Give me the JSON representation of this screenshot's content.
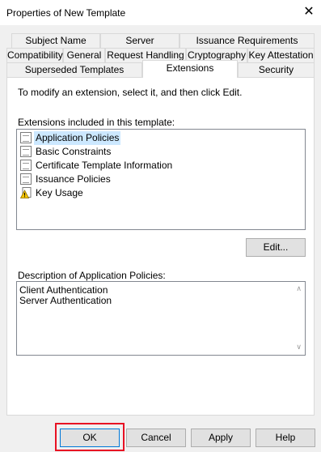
{
  "window": {
    "title": "Properties of New Template",
    "close_glyph": "✕"
  },
  "tabs": {
    "row1": [
      "Subject Name",
      "Server",
      "Issuance Requirements"
    ],
    "row2": [
      "Compatibility",
      "General",
      "Request Handling",
      "Cryptography",
      "Key Attestation"
    ],
    "row3": [
      "Superseded Templates",
      "Extensions",
      "Security"
    ],
    "active": "Extensions"
  },
  "extensions_tab": {
    "instruction": "To modify an extension, select it, and then click Edit.",
    "list_label": "Extensions included in this template:",
    "extensions": [
      {
        "label": "Application Policies",
        "icon": "document-icon",
        "selected": true
      },
      {
        "label": "Basic Constraints",
        "icon": "document-icon",
        "selected": false
      },
      {
        "label": "Certificate Template Information",
        "icon": "document-icon",
        "selected": false
      },
      {
        "label": "Issuance Policies",
        "icon": "document-icon",
        "selected": false
      },
      {
        "label": "Key Usage",
        "icon": "warning-document-icon",
        "selected": false
      }
    ],
    "edit_button": "Edit...",
    "description_label": "Description of Application Policies:",
    "description_lines": [
      "Client Authentication",
      "Server Authentication"
    ]
  },
  "footer": {
    "ok": "OK",
    "cancel": "Cancel",
    "apply": "Apply",
    "help": "Help"
  },
  "colors": {
    "selection": "#cce8ff",
    "highlight_border": "#e81123",
    "default_button_border": "#0078d7"
  }
}
